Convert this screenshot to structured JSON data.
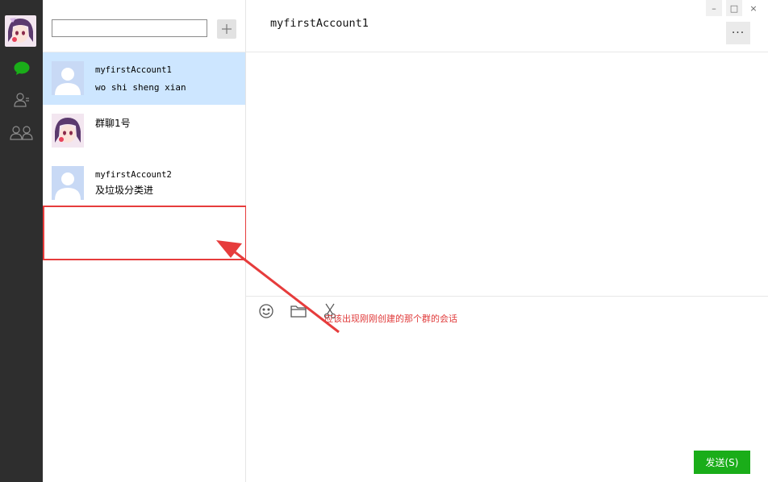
{
  "sidebar": {
    "nav": [
      "chat-icon",
      "contacts-icon",
      "groups-icon"
    ],
    "accent": "#1aad19"
  },
  "search": {
    "value": "",
    "placeholder": ""
  },
  "conversations": [
    {
      "name": "myfirstAccount1",
      "last_message": "wo shi sheng xian",
      "selected": true
    },
    {
      "name": "群聊1号",
      "last_message": ""
    },
    {
      "name": "myfirstAccount2",
      "last_message": "及垃圾分类进"
    }
  ],
  "chat": {
    "title": "myfirstAccount1",
    "send_label": "发送(S)",
    "tools": [
      "emoji-icon",
      "folder-icon",
      "scissors-icon"
    ]
  },
  "annotation": {
    "text": "应该出现刚刚创建的那个群的会话",
    "color": "#e63c3c"
  },
  "window": {
    "minimize": "–",
    "maximize": "□",
    "close": "×",
    "more": "···"
  }
}
